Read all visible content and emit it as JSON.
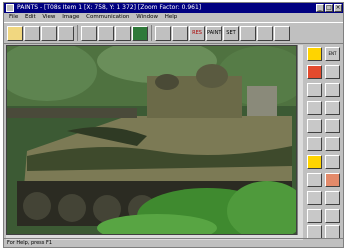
{
  "app": {
    "title": "PAINTS - [T08s Item 1  [X: 758, Y: 1 372]  [Zoom Factor: 0.961]"
  },
  "menu": [
    "File",
    "Edit",
    "View",
    "Image",
    "Communication",
    "Window",
    "Help"
  ],
  "toolbar": {
    "text_buttons": [
      "RES",
      "PAINT",
      "SET"
    ]
  },
  "right_panel": {
    "top_label": "ENT"
  },
  "status": {
    "text": "For Help, press F1"
  },
  "colors": {
    "titlebar": "#000080",
    "chrome": "#c0c0c0"
  }
}
